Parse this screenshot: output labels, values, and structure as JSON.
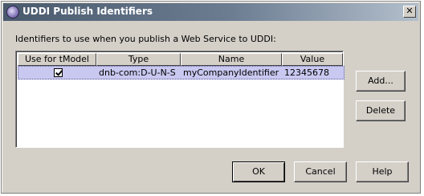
{
  "window": {
    "title": "UDDI Publish Identifiers",
    "close_glyph": "✕"
  },
  "instruction": "Identifiers to use when you publish a Web Service to UDDI:",
  "table": {
    "columns": [
      "Use for tModel",
      "Type",
      "Name",
      "Value"
    ],
    "rows": [
      {
        "use_for_tmodel": true,
        "type": "dnb-com:D-U-N-S",
        "name": "myCompanyIdentifier",
        "value": "12345678"
      }
    ]
  },
  "buttons": {
    "add": "Add...",
    "delete": "Delete",
    "ok": "OK",
    "cancel": "Cancel",
    "help": "Help"
  },
  "colors": {
    "titlebar_start": "#4a5a6d",
    "titlebar_end": "#b3bfcc",
    "dialog_bg": "#d4d0c8",
    "selected_row": "#c8c8f0"
  },
  "icons": {
    "app": "uddi-globe-icon",
    "close": "close-icon",
    "checkbox": "checkbox-checked-icon"
  }
}
